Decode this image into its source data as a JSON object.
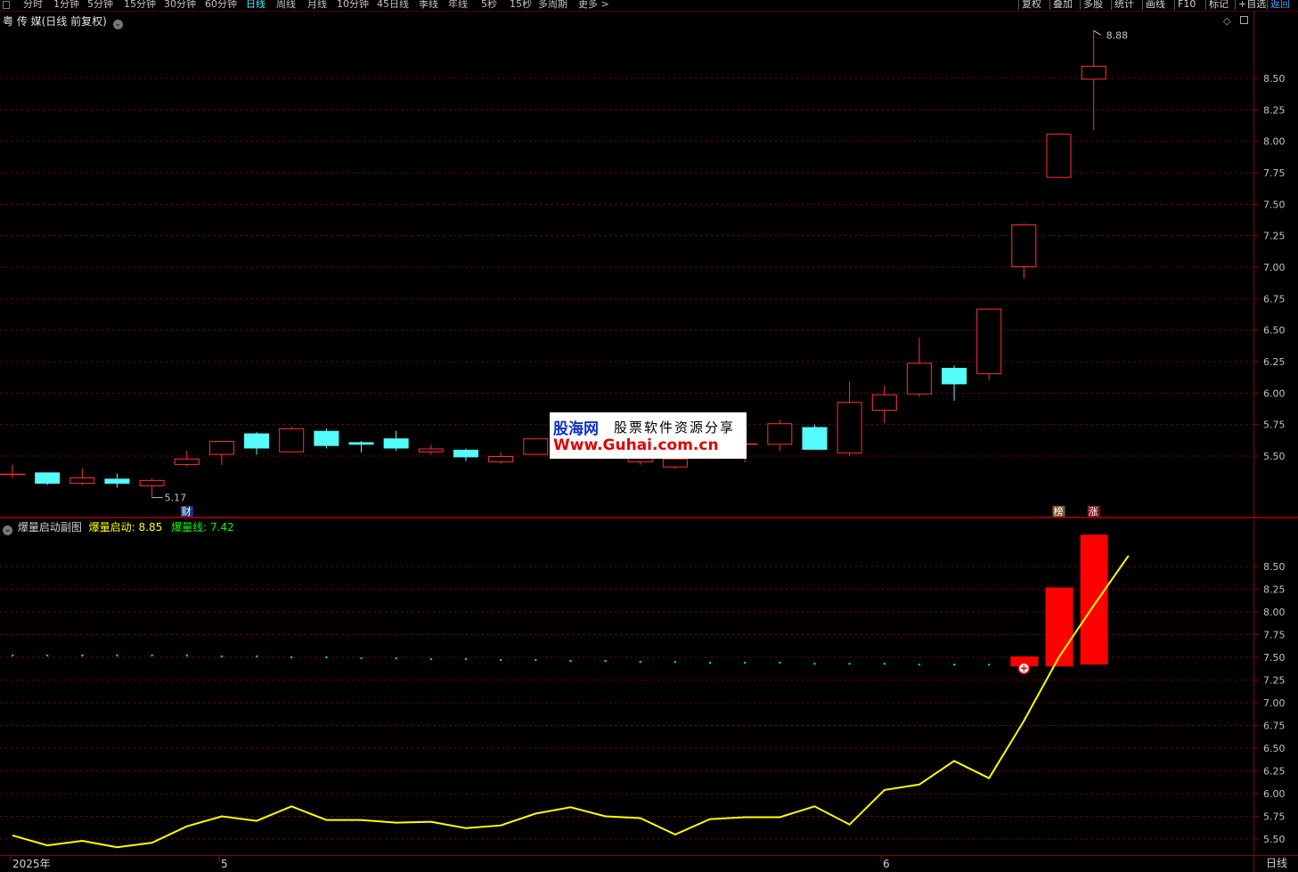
{
  "toolbar": {
    "periods": [
      "分时",
      "1分钟",
      "5分钟",
      "15分钟",
      "30分钟",
      "60分钟",
      "日线",
      "周线",
      "月线",
      "10分钟",
      "45日线",
      "季线",
      "年线",
      "5秒",
      "15秒",
      "多周期",
      "更多 >"
    ],
    "active_period": "日线",
    "buttons": [
      "复权",
      "叠加",
      "多股",
      "统计",
      "画线",
      "F10",
      "标记",
      "+自选",
      "返回"
    ]
  },
  "main_chart": {
    "title": "粤 传 媒(日线 前复权)",
    "y_ticks": [
      8.5,
      8.25,
      8.0,
      7.75,
      7.5,
      7.25,
      7.0,
      6.75,
      6.5,
      6.25,
      6.0,
      5.75,
      5.5
    ],
    "annotations": {
      "high_label": "8.88",
      "low_label": "5.17",
      "cai_marker": "财",
      "bang_marker": "榜",
      "zhang_marker": "涨"
    },
    "colors": {
      "up": "#ff3232",
      "down": "#54fcfc",
      "grid": "#8b0000",
      "axis": "#c0c0c0"
    }
  },
  "sub_chart": {
    "title": "爆量启动副图",
    "indicator1_label": "爆量启动:",
    "indicator1_value": "8.85",
    "indicator2_label": "爆量线:",
    "indicator2_value": "7.42",
    "y_ticks": [
      8.5,
      8.25,
      8.0,
      7.75,
      7.5,
      7.25,
      7.0,
      6.75,
      6.5,
      6.25,
      6.0,
      5.75,
      5.5
    ],
    "colors": {
      "line": "#ffff00",
      "dots": "#00ff00",
      "bars": "#ff0000"
    }
  },
  "bottom_axis": {
    "labels": [
      "2025年",
      "5",
      "6"
    ],
    "period": "日线"
  },
  "watermark": {
    "logo": "股海网",
    "slogan": "股票软件资源分享",
    "url": "Www.Guhai.com.cn"
  },
  "chart_data": [
    {
      "type": "candlestick",
      "title": "粤 传 媒(日线 前复权)",
      "ylim": [
        5.2,
        8.95
      ],
      "candles": [
        {
          "o": 5.36,
          "h": 5.43,
          "l": 5.33,
          "c": 5.36
        },
        {
          "o": 5.37,
          "h": 5.37,
          "l": 5.27,
          "c": 5.28
        },
        {
          "o": 5.28,
          "h": 5.4,
          "l": 5.27,
          "c": 5.33
        },
        {
          "o": 5.32,
          "h": 5.36,
          "l": 5.25,
          "c": 5.28
        },
        {
          "o": 5.26,
          "h": 5.32,
          "l": 5.17,
          "c": 5.31
        },
        {
          "o": 5.43,
          "h": 5.54,
          "l": 5.42,
          "c": 5.48
        },
        {
          "o": 5.51,
          "h": 5.62,
          "l": 5.43,
          "c": 5.62
        },
        {
          "o": 5.68,
          "h": 5.69,
          "l": 5.51,
          "c": 5.56
        },
        {
          "o": 5.53,
          "h": 5.73,
          "l": 5.53,
          "c": 5.72
        },
        {
          "o": 5.7,
          "h": 5.72,
          "l": 5.56,
          "c": 5.58
        },
        {
          "o": 5.61,
          "h": 5.62,
          "l": 5.53,
          "c": 5.59
        },
        {
          "o": 5.64,
          "h": 5.7,
          "l": 5.54,
          "c": 5.56
        },
        {
          "o": 5.53,
          "h": 5.59,
          "l": 5.51,
          "c": 5.56
        },
        {
          "o": 5.55,
          "h": 5.56,
          "l": 5.46,
          "c": 5.49
        },
        {
          "o": 5.45,
          "h": 5.53,
          "l": 5.44,
          "c": 5.5
        },
        {
          "o": 5.51,
          "h": 5.64,
          "l": 5.51,
          "c": 5.64
        },
        {
          "o": 5.63,
          "h": 5.64,
          "l": 5.6,
          "c": 5.62
        },
        {
          "o": 5.62,
          "h": 5.63,
          "l": 5.49,
          "c": 5.52
        },
        {
          "o": 5.45,
          "h": 5.53,
          "l": 5.43,
          "c": 5.52
        },
        {
          "o": 5.41,
          "h": 5.49,
          "l": 5.4,
          "c": 5.48
        },
        {
          "o": 5.55,
          "h": 5.6,
          "l": 5.55,
          "c": 5.58
        },
        {
          "o": 5.59,
          "h": 5.59,
          "l": 5.45,
          "c": 5.6
        },
        {
          "o": 5.59,
          "h": 5.79,
          "l": 5.54,
          "c": 5.76
        },
        {
          "o": 5.73,
          "h": 5.75,
          "l": 5.55,
          "c": 5.55
        },
        {
          "o": 5.52,
          "h": 6.09,
          "l": 5.5,
          "c": 5.93
        },
        {
          "o": 5.86,
          "h": 6.06,
          "l": 5.76,
          "c": 5.99
        },
        {
          "o": 5.99,
          "h": 6.44,
          "l": 5.97,
          "c": 6.24
        },
        {
          "o": 6.2,
          "h": 6.22,
          "l": 5.94,
          "c": 6.07
        },
        {
          "o": 6.15,
          "h": 6.15,
          "l": 6.1,
          "c": 6.67
        },
        {
          "o": 7.0,
          "h": 7.35,
          "l": 6.91,
          "c": 7.34
        },
        {
          "o": 7.71,
          "h": 8.06,
          "l": 7.71,
          "c": 8.06
        },
        {
          "o": 8.49,
          "h": 8.88,
          "l": 8.09,
          "c": 8.6
        }
      ]
    },
    {
      "type": "line",
      "title": "爆量启动副图",
      "ylim": [
        5.42,
        8.98
      ],
      "series": [
        {
          "name": "爆量启动",
          "color": "#ffff00",
          "values": [
            5.54,
            5.43,
            5.48,
            5.41,
            5.46,
            5.64,
            5.75,
            5.7,
            5.86,
            5.71,
            5.71,
            5.68,
            5.69,
            5.62,
            5.65,
            5.78,
            5.85,
            5.75,
            5.73,
            5.55,
            5.72,
            5.74,
            5.74,
            5.86,
            5.66,
            6.04,
            6.1,
            6.36,
            6.17,
            6.8,
            7.5,
            8.07,
            8.62
          ]
        },
        {
          "name": "爆量线",
          "color": "#00ff00",
          "values": [
            7.52,
            7.52,
            7.52,
            7.52,
            7.52,
            7.52,
            7.51,
            7.51,
            7.5,
            7.5,
            7.49,
            7.49,
            7.48,
            7.48,
            7.47,
            7.47,
            7.46,
            7.46,
            7.45,
            7.45,
            7.44,
            7.44,
            7.44,
            7.43,
            7.43,
            7.43,
            7.42,
            7.42,
            7.42,
            7.42
          ]
        }
      ],
      "bars": [
        {
          "index": 29,
          "low": 7.4,
          "high": 7.51
        },
        {
          "index": 30,
          "low": 7.4,
          "high": 8.27
        },
        {
          "index": 31,
          "low": 7.42,
          "high": 8.85
        }
      ]
    }
  ]
}
